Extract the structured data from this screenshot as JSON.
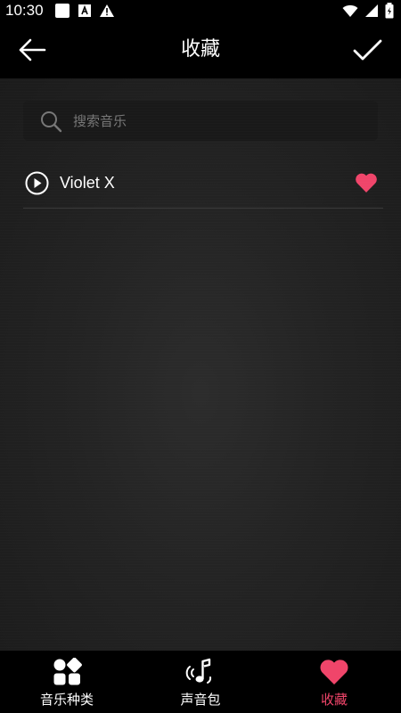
{
  "status_bar": {
    "time": "10:30",
    "icons": [
      "square-icon",
      "a-badge-icon",
      "warning-icon",
      "wifi-icon",
      "signal-icon",
      "battery-icon"
    ]
  },
  "header": {
    "title": "收藏"
  },
  "search": {
    "placeholder": "搜索音乐"
  },
  "favorites": [
    {
      "title": "Violet X",
      "favorited": true
    }
  ],
  "bottom_nav": [
    {
      "label": "音乐种类",
      "icon": "grid-shapes-icon",
      "active": false
    },
    {
      "label": "声音包",
      "icon": "music-note-icon",
      "active": false
    },
    {
      "label": "收藏",
      "icon": "heart-icon",
      "active": true
    }
  ],
  "colors": {
    "accent": "#f0456a",
    "background": "#000000",
    "panel": "#232323"
  }
}
